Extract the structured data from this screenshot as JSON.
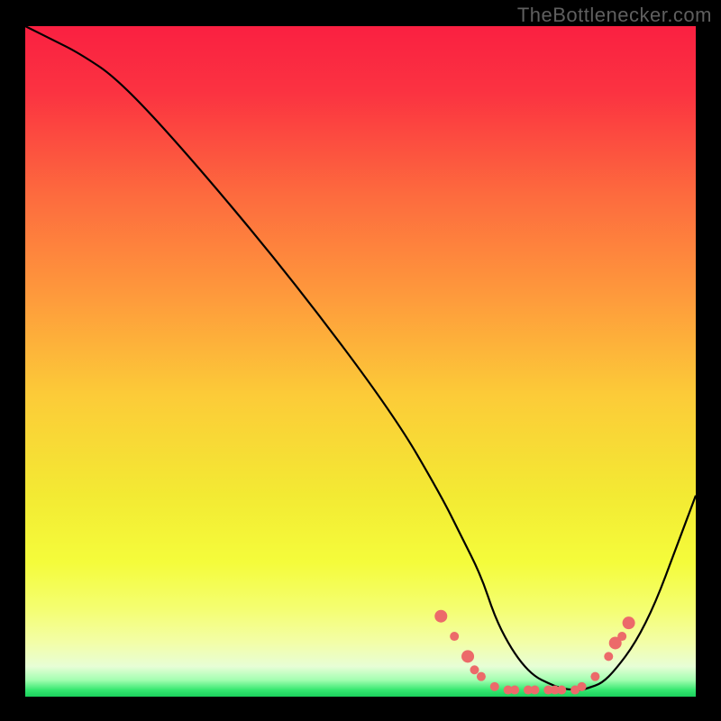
{
  "watermark": "TheBottlenecker.com",
  "chart_data": {
    "type": "line",
    "title": "",
    "xlabel": "",
    "ylabel": "",
    "xlim": [
      0,
      100
    ],
    "ylim": [
      0,
      100
    ],
    "grid": false,
    "legend": false,
    "background": {
      "type": "vertical-gradient",
      "stops": [
        {
          "pos": 0.0,
          "color": "#fa2041"
        },
        {
          "pos": 0.1,
          "color": "#fb3341"
        },
        {
          "pos": 0.25,
          "color": "#fd6a3e"
        },
        {
          "pos": 0.4,
          "color": "#fe993c"
        },
        {
          "pos": 0.55,
          "color": "#fccb38"
        },
        {
          "pos": 0.7,
          "color": "#f3ea33"
        },
        {
          "pos": 0.8,
          "color": "#f4fc3b"
        },
        {
          "pos": 0.87,
          "color": "#f4fe72"
        },
        {
          "pos": 0.92,
          "color": "#f3fea8"
        },
        {
          "pos": 0.955,
          "color": "#e7fed6"
        },
        {
          "pos": 0.975,
          "color": "#a4feb1"
        },
        {
          "pos": 0.99,
          "color": "#35e870"
        },
        {
          "pos": 1.0,
          "color": "#1ad05c"
        }
      ]
    },
    "series": [
      {
        "name": "bottleneck-curve",
        "color": "#000000",
        "x": [
          0,
          4,
          8,
          14,
          25,
          40,
          55,
          62,
          65,
          68,
          70,
          72,
          74,
          76,
          78,
          80,
          82,
          83,
          84,
          86,
          88,
          91,
          94,
          97,
          100
        ],
        "y": [
          100,
          98,
          96,
          92,
          80,
          62,
          42,
          30,
          24,
          18,
          12,
          8,
          5,
          3,
          2,
          1.2,
          1,
          1,
          1.3,
          2,
          4,
          8,
          14,
          22,
          30
        ]
      }
    ],
    "points": {
      "name": "highlighted-points",
      "color": "#ec6a6a",
      "radius_small": 5,
      "radius_large": 7,
      "items": [
        {
          "x": 62,
          "y": 12,
          "r": 7
        },
        {
          "x": 64,
          "y": 9,
          "r": 5
        },
        {
          "x": 66,
          "y": 6,
          "r": 7
        },
        {
          "x": 67,
          "y": 4,
          "r": 5
        },
        {
          "x": 68,
          "y": 3,
          "r": 5
        },
        {
          "x": 70,
          "y": 1.5,
          "r": 5
        },
        {
          "x": 72,
          "y": 1,
          "r": 5
        },
        {
          "x": 73,
          "y": 1,
          "r": 5
        },
        {
          "x": 75,
          "y": 1,
          "r": 5
        },
        {
          "x": 76,
          "y": 1,
          "r": 5
        },
        {
          "x": 78,
          "y": 1,
          "r": 5
        },
        {
          "x": 79,
          "y": 1,
          "r": 5
        },
        {
          "x": 80,
          "y": 1,
          "r": 5
        },
        {
          "x": 82,
          "y": 1,
          "r": 5
        },
        {
          "x": 83,
          "y": 1.5,
          "r": 5
        },
        {
          "x": 85,
          "y": 3,
          "r": 5
        },
        {
          "x": 87,
          "y": 6,
          "r": 5
        },
        {
          "x": 88,
          "y": 8,
          "r": 7
        },
        {
          "x": 89,
          "y": 9,
          "r": 5
        },
        {
          "x": 90,
          "y": 11,
          "r": 7
        }
      ]
    }
  }
}
